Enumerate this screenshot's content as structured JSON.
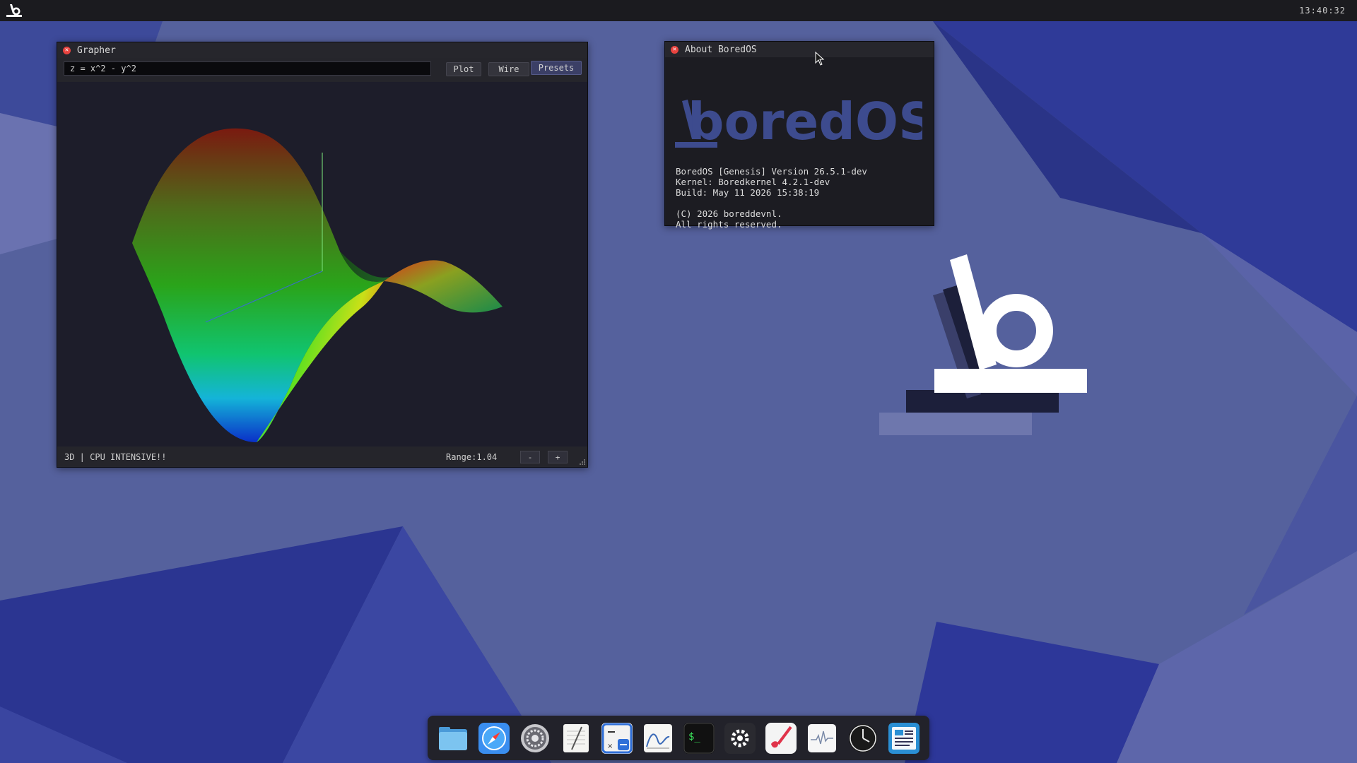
{
  "topbar": {
    "clock": "13:40:32"
  },
  "grapher": {
    "title": "Grapher",
    "expression": "z = x^2 - y^2",
    "buttons": {
      "plot": "Plot",
      "wire": "Wire",
      "presets": "Presets"
    },
    "status": {
      "mode": "3D | CPU INTENSIVE!!",
      "range": "Range:1.04",
      "minus": "-",
      "plus": "+"
    }
  },
  "about": {
    "title": "About BoredOS",
    "logo_text": "boredOS",
    "version_line": "BoredOS [Genesis] Version 26.5.1-dev",
    "kernel_line": "Kernel: Boredkernel 4.2.1-dev",
    "build_line": "Build: May 11 2026 15:38:19",
    "copyright_line": "(C) 2026 boreddevnl.",
    "rights_line": "All rights reserved."
  },
  "dock": {
    "items": [
      "files-icon",
      "browser-compass-icon",
      "settings-gear-icon",
      "notepad-icon",
      "calculator-icon",
      "grapher-icon",
      "terminal-icon",
      "system-settings-icon",
      "paint-icon",
      "activity-monitor-icon",
      "clock-icon",
      "document-viewer-icon"
    ]
  },
  "colors": {
    "accent": "#e8433f",
    "wallpaper": "#4e5d9c",
    "dock_active": "#2a8fd4"
  }
}
